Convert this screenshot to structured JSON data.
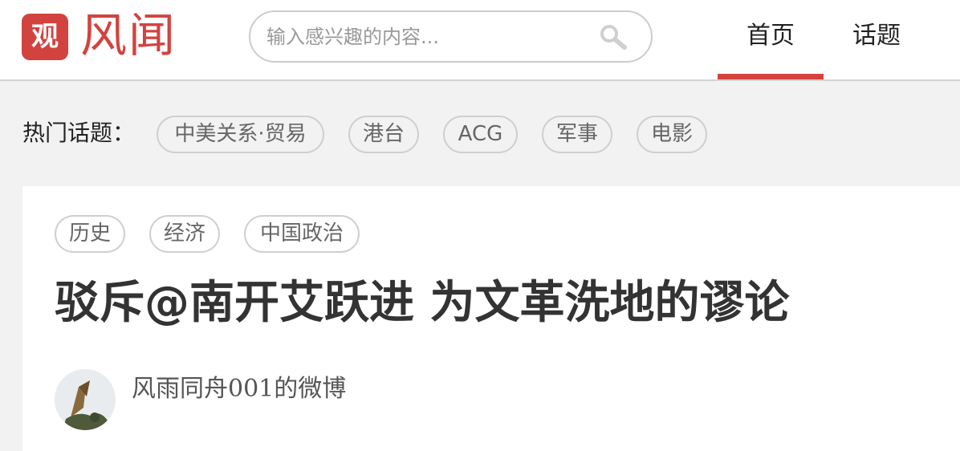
{
  "colors": {
    "accent": "#d2433f",
    "pill_border": "#cfcfcf",
    "background": "#f2f2f2"
  },
  "header": {
    "logo_glyph": "观",
    "logo_text": "风闻",
    "search": {
      "placeholder": "输入感兴趣的内容...",
      "icon": "search-icon"
    },
    "nav": {
      "home": "首页",
      "topics": "话题",
      "active": "home"
    }
  },
  "hot_topics": {
    "label": "热门话题：",
    "items": [
      "中美关系·贸易",
      "港台",
      "ACG",
      "军事",
      "电影"
    ]
  },
  "article": {
    "tags": [
      "历史",
      "经济",
      "中国政治"
    ],
    "title": "驳斥@南开艾跃进 为文革洗地的谬论",
    "author": "风雨同舟001的微博"
  }
}
